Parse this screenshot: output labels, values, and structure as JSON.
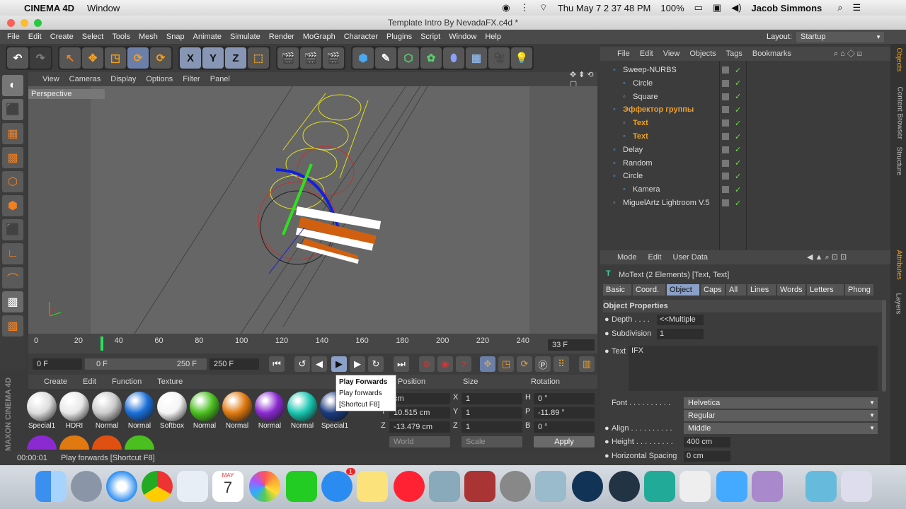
{
  "mac_menubar": {
    "app_name": "CINEMA 4D",
    "window_menu": "Window",
    "datetime": "Thu May 7  2 37 48 PM",
    "battery": "100%",
    "user": "Jacob Simmons"
  },
  "window": {
    "title": "Template Intro By NevadaFX.c4d *"
  },
  "menu": {
    "items": [
      "File",
      "Edit",
      "Create",
      "Select",
      "Tools",
      "Mesh",
      "Snap",
      "Animate",
      "Simulate",
      "Render",
      "MoGraph",
      "Character",
      "Plugins",
      "Script",
      "Window",
      "Help"
    ],
    "layout_label": "Layout:",
    "layout_value": "Startup"
  },
  "toolbar": {
    "axis_x": "X",
    "axis_y": "Y",
    "axis_z": "Z"
  },
  "viewport": {
    "menu": [
      "View",
      "Cameras",
      "Display",
      "Options",
      "Filter",
      "Panel"
    ],
    "label": "Perspective"
  },
  "timeline": {
    "ticks": [
      "0",
      "20",
      "40",
      "60",
      "80",
      "100",
      "120",
      "140",
      "160",
      "180",
      "200",
      "220",
      "240"
    ],
    "current_frame_display": "33 F",
    "current_frame_fraction": 0.132
  },
  "transport": {
    "start_field": "0 F",
    "range_start": "0 F",
    "range_end": "250 F",
    "end_field": "250 F"
  },
  "tooltip": {
    "title": "Play Forwards",
    "line1": "Play forwards",
    "line2": "[Shortcut F8]"
  },
  "materials": {
    "menu": [
      "Create",
      "Edit",
      "Function",
      "Texture"
    ],
    "items": [
      {
        "label": "Special1",
        "color": "#dddddd"
      },
      {
        "label": "HDRI",
        "color": "#e8e8e8"
      },
      {
        "label": "Normal",
        "color": "#cccccc"
      },
      {
        "label": "Normal",
        "color": "#1a6fd8"
      },
      {
        "label": "Softbox",
        "color": "#f5f5f5"
      },
      {
        "label": "Normal",
        "color": "#4bbf20"
      },
      {
        "label": "Normal",
        "color": "#e07a10"
      },
      {
        "label": "Normal",
        "color": "#8a2ad0"
      },
      {
        "label": "Normal",
        "color": "#19c6b0"
      },
      {
        "label": "Special1",
        "color": "#1a3a80"
      }
    ]
  },
  "coordinates": {
    "headers": [
      "Position",
      "Size",
      "Rotation"
    ],
    "rows": [
      {
        "axis": "X",
        "pos": "cm",
        "size_axis": "X",
        "size": "1",
        "rot_axis": "H",
        "rot": "0 °"
      },
      {
        "axis": "Y",
        "pos": "10.515 cm",
        "size_axis": "Y",
        "size": "1",
        "rot_axis": "P",
        "rot": "-11.89 °"
      },
      {
        "axis": "Z",
        "pos": "-13.479 cm",
        "size_axis": "Z",
        "size": "1",
        "rot_axis": "B",
        "rot": "0 °"
      }
    ],
    "mode1": "World",
    "mode2": "Scale",
    "apply": "Apply"
  },
  "status": {
    "time": "00:00:01",
    "message": "Play forwards [Shortcut F8]"
  },
  "objects": {
    "menu": [
      "File",
      "Edit",
      "View",
      "Objects",
      "Tags",
      "Bookmarks"
    ],
    "items": [
      {
        "name": "Sweep-NURBS",
        "indent": 0,
        "color": "#dddddd"
      },
      {
        "name": "Circle",
        "indent": 1,
        "color": "#dddddd"
      },
      {
        "name": "Square",
        "indent": 1,
        "color": "#dddddd"
      },
      {
        "name": "Эффектор группы",
        "indent": 0,
        "color": "#e8a030"
      },
      {
        "name": "Text",
        "indent": 1,
        "color": "#f0a020"
      },
      {
        "name": "Text",
        "indent": 1,
        "color": "#f0a020"
      },
      {
        "name": "Delay",
        "indent": 0,
        "color": "#dddddd"
      },
      {
        "name": "Random",
        "indent": 0,
        "color": "#dddddd"
      },
      {
        "name": "Circle",
        "indent": 0,
        "color": "#dddddd"
      },
      {
        "name": "Kamera",
        "indent": 1,
        "color": "#dddddd"
      },
      {
        "name": "MiguelArtz Lightroom V.5",
        "indent": 0,
        "color": "#dddddd"
      }
    ]
  },
  "attributes": {
    "menu": [
      "Mode",
      "Edit",
      "User Data"
    ],
    "object_title": "MoText (2 Elements) [Text, Text]",
    "tabs": [
      "Basic",
      "Coord.",
      "Object",
      "Caps",
      "All",
      "Lines",
      "Words",
      "Letters",
      "Phong"
    ],
    "active_tab": "Object",
    "section": "Object Properties",
    "depth_label": "Depth . . . .",
    "depth_value": "<<Multiple",
    "subdivision_label": "Subdivision",
    "subdivision_value": "1",
    "text_label": "Text",
    "text_value": "IFX",
    "font_label": "Font . . . . . . . . . .",
    "font_value": "Helvetica",
    "font_style": "Regular",
    "align_label": "Align . . . . . . . . . .",
    "align_value": "Middle",
    "height_label": "Height . . . . . . . . .",
    "height_value": "400 cm",
    "hspacing_label": "Horizontal Spacing",
    "hspacing_value": "0 cm"
  },
  "right_tabs": [
    "Objects",
    "Content Browser",
    "Structure",
    "Attributes",
    "Layers"
  ],
  "side_brand": "MAXON CINEMA 4D",
  "dock": {
    "calendar_month": "MAY",
    "calendar_day": "7",
    "badge": "1"
  }
}
